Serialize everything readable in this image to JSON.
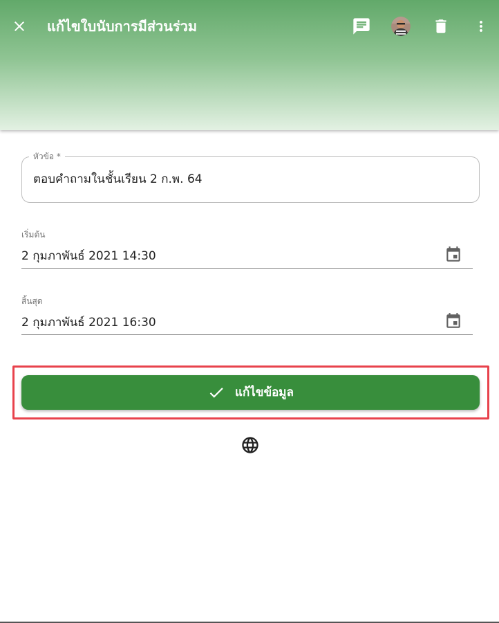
{
  "appbar": {
    "title": "แก้ไขใบนับการมีส่วนร่วม",
    "icons": {
      "close": "close-icon",
      "chat": "chat-icon",
      "avatar": "user-avatar",
      "delete": "trash-icon",
      "more": "more-vert-icon"
    },
    "gradient_top": "#62a96a",
    "gradient_bottom": "#e3f1e3"
  },
  "form": {
    "title_field": {
      "label": "หัวข้อ *",
      "value": "ตอบคำถามในชั้นเรียน 2 ก.พ. 64"
    },
    "start_field": {
      "label": "เริ่มต้น",
      "value": "2 กุมภาพันธ์ 2021 14:30",
      "icon": "calendar-icon"
    },
    "end_field": {
      "label": "สิ้นสุด",
      "value": "2 กุมภาพันธ์ 2021 16:30",
      "icon": "calendar-icon"
    },
    "save_button": {
      "label": "แก้ไขข้อมูล",
      "icon": "check-icon",
      "color": "#388e3c",
      "highlight_color": "#e8424c"
    },
    "language_icon": "globe-icon"
  }
}
